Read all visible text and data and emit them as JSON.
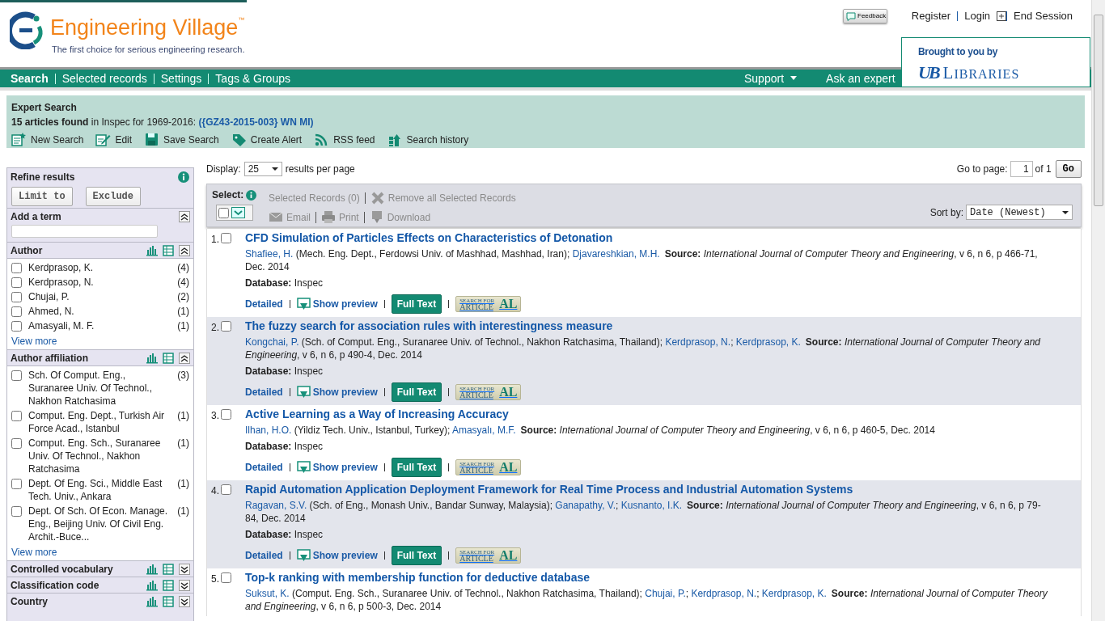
{
  "header": {
    "logo_text": "Engineering Village",
    "trademark": "™",
    "tagline": "The first choice for serious engineering research.",
    "feedback": "Feedback",
    "top_links": [
      {
        "label": "Register",
        "icon": false
      },
      {
        "label": "Login",
        "icon": true
      },
      {
        "label": "End Session",
        "icon": false
      }
    ],
    "sponsor": {
      "caption": "Brought to you by",
      "mark": "UB",
      "name": "LIBRARIES"
    }
  },
  "nav": {
    "items": [
      {
        "label": "Search",
        "selected": true
      },
      {
        "label": "Selected records",
        "selected": false
      },
      {
        "label": "Settings",
        "selected": false
      },
      {
        "label": "Tags & Groups",
        "selected": false
      }
    ],
    "right": [
      {
        "label": "Support",
        "dropdown": true
      },
      {
        "label": "Ask an expert",
        "dropdown": false
      }
    ]
  },
  "search_summary": {
    "title": "Expert Search",
    "summary": "**15 articles found** in Inspec for 1969-2016: ",
    "query": "({GZ43-2015-003} WN MI)",
    "tools": [
      {
        "label": "New Search",
        "kind": "new"
      },
      {
        "label": "Edit",
        "kind": "edit"
      },
      {
        "label": "Save Search",
        "kind": "save"
      },
      {
        "label": "Create Alert",
        "kind": "alert"
      },
      {
        "label": "RSS feed",
        "kind": "rss"
      },
      {
        "label": "Search history",
        "kind": "history"
      }
    ]
  },
  "refine": {
    "title": "Refine results",
    "buttons": [
      "Limit to",
      "Exclude"
    ],
    "sections": [
      {
        "title": "Add a term",
        "kind": "term",
        "expanded": true
      },
      {
        "title": "Author",
        "kind": "facet",
        "expanded": true,
        "view_more": "View more",
        "items": [
          {
            "label": "Kerdprasop, K.",
            "count": "(4)",
            "checked": false
          },
          {
            "label": "Kerdprasop, N.",
            "count": "(4)",
            "checked": false
          },
          {
            "label": "Chujai, P.",
            "count": "(2)",
            "checked": false
          },
          {
            "label": "Ahmed, N.",
            "count": "(1)",
            "checked": false
          },
          {
            "label": "Amasyali, M. F.",
            "count": "(1)",
            "checked": false
          }
        ]
      },
      {
        "title": "Author affiliation",
        "kind": "facet",
        "expanded": true,
        "view_more": "View more",
        "items": [
          {
            "label": "Sch. Of Comput. Eng., Suranaree Univ. Of Technol., Nakhon Ratchasima",
            "count": "(3)",
            "checked": false
          },
          {
            "label": "Comput. Eng. Dept., Turkish Air Force Acad., Istanbul",
            "count": "(1)",
            "checked": false
          },
          {
            "label": "Comput. Eng. Sch., Suranaree Univ. Of Technol., Nakhon Ratchasima",
            "count": "(1)",
            "checked": false
          },
          {
            "label": "Dept. Of Eng. Sci., Middle East Tech. Univ., Ankara",
            "count": "(1)",
            "checked": false
          },
          {
            "label": "Dept. Of Sch. Of Econ. Manage. Eng., Beijing Univ. Of Civil Eng. Archit.-Buce...",
            "count": "(1)",
            "checked": false
          }
        ]
      },
      {
        "title": "Controlled vocabulary",
        "kind": "facet",
        "expanded": false
      },
      {
        "title": "Classification code",
        "kind": "facet",
        "expanded": false
      },
      {
        "title": "Country",
        "kind": "facet",
        "expanded": false
      }
    ]
  },
  "display": {
    "label": "Display:",
    "value": "25",
    "suffix": "results per page",
    "goto_label": "Go to page:",
    "page": "1",
    "of": "of 1",
    "go": "Go"
  },
  "select_bar": {
    "label": "Select:",
    "select_all_checked": false,
    "selected_records": {
      "label": "Selected Records (0)",
      "disabled": true
    },
    "remove": {
      "label": "Remove all Selected Records",
      "disabled": true
    },
    "actions": [
      {
        "label": "Email",
        "kind": "email",
        "disabled": true
      },
      {
        "label": "Print",
        "kind": "print",
        "disabled": true
      },
      {
        "label": "Download",
        "kind": "download",
        "disabled": true
      }
    ],
    "sort_label": "Sort by:",
    "sort_value": "Date (Newest)"
  },
  "results": [
    {
      "number": "1.",
      "checked": false,
      "title": "CFD Simulation of Particles Effects on Characteristics of Detonation",
      "authors": [
        {
          "name": "Shafiee, H.",
          "after": " (Mech. Eng. Dept., Ferdowsi Univ. of Mashhad, Mashhad, Iran); "
        },
        {
          "name": "Djavareshkian, M.H."
        }
      ],
      "source": "**Source:** *International Journal of Computer Theory and Engineering*, v 6, n 6, p 466-71, Dec. 2014",
      "database": "**Database:** Inspec",
      "actions": {
        "detailed": "Detailed",
        "preview": "Show preview",
        "full_text": "Full Text",
        "article_top": "SEARCH FOR",
        "article_bottom": "ARTICLE",
        "article_mark": "AL"
      }
    },
    {
      "number": "2.",
      "checked": false,
      "title": "The fuzzy search for association rules with interestingness measure",
      "authors": [
        {
          "name": "Kongchai, P.",
          "after": " (Sch. of Comput. Eng., Suranaree Univ. of Technol., Nakhon Ratchasima, Thailand); "
        },
        {
          "name": "Kerdprasop, N.",
          "after": "; "
        },
        {
          "name": "Kerdprasop, K."
        }
      ],
      "source": "**Source:** *International Journal of Computer Theory and Engineering*, v 6, n 6, p 490-4, Dec. 2014",
      "database": "**Database:** Inspec",
      "actions": {
        "detailed": "Detailed",
        "preview": "Show preview",
        "full_text": "Full Text",
        "article_top": "SEARCH FOR",
        "article_bottom": "ARTICLE",
        "article_mark": "AL"
      }
    },
    {
      "number": "3.",
      "checked": false,
      "title": "Active Learning as a Way of Increasing Accuracy",
      "authors": [
        {
          "name": "Ilhan, H.O.",
          "after": " (Yildiz Tech. Univ., Istanbul, Turkey); "
        },
        {
          "name": "Amasyalı, M.F."
        }
      ],
      "source": "**Source:** *International Journal of Computer Theory and Engineering*, v 6, n 6, p 460-5, Dec. 2014",
      "database": "**Database:** Inspec",
      "actions": {
        "detailed": "Detailed",
        "preview": "Show preview",
        "full_text": "Full Text",
        "article_top": "SEARCH FOR",
        "article_bottom": "ARTICLE",
        "article_mark": "AL"
      }
    },
    {
      "number": "4.",
      "checked": false,
      "title": "Rapid Automation Application Deployment Framework for Real Time Process and Industrial Automation Systems",
      "authors": [
        {
          "name": "Ragavan, S.V.",
          "after": " (Sch. of Eng., Monash Univ., Bandar Sunway, Malaysia); "
        },
        {
          "name": "Ganapathy, V.",
          "after": "; "
        },
        {
          "name": "Kusnanto, I.K."
        }
      ],
      "source": "**Source:** *International Journal of Computer Theory and Engineering*, v 6, n 6, p 79-84, Dec. 2014",
      "database": "**Database:** Inspec",
      "actions": {
        "detailed": "Detailed",
        "preview": "Show preview",
        "full_text": "Full Text",
        "article_top": "SEARCH FOR",
        "article_bottom": "ARTICLE",
        "article_mark": "AL"
      }
    },
    {
      "number": "5.",
      "checked": false,
      "title": "Top-k ranking with membership function for deductive database",
      "authors": [
        {
          "name": "Suksut, K.",
          "after": " (Comput. Eng. Sch., Suranaree Univ. of Technol., Nakhon Ratchasima, Thailand); "
        },
        {
          "name": "Chujai, P.",
          "after": "; "
        },
        {
          "name": "Kerdprasop, N.",
          "after": "; "
        },
        {
          "name": "Kerdprasop, K."
        }
      ],
      "source": "**Source:** *International Journal of Computer Theory and Engineering*, v 6, n 6, p 500-3, Dec. 2014"
    }
  ]
}
